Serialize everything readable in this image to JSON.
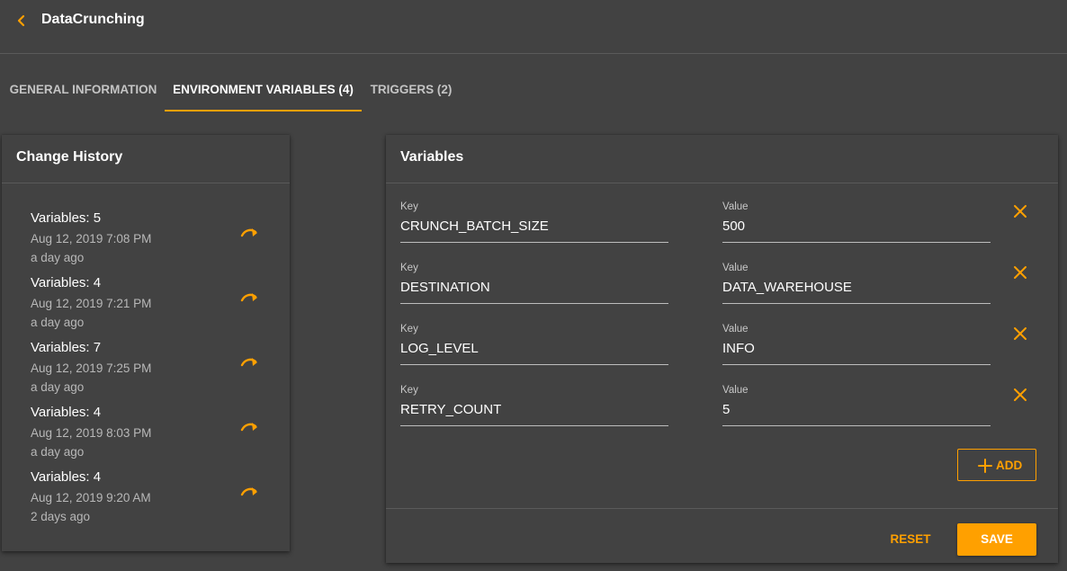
{
  "app": {
    "title": "DataCrunching"
  },
  "tabs": [
    {
      "label": "GENERAL INFORMATION",
      "active": false
    },
    {
      "label": "ENVIRONMENT VARIABLES (4)",
      "active": true
    },
    {
      "label": "TRIGGERS (2)",
      "active": false
    }
  ],
  "history": {
    "title": "Change History",
    "items": [
      {
        "title": "Variables: 5",
        "date": "Aug 12, 2019 7:08 PM",
        "ago": "a day ago"
      },
      {
        "title": "Variables: 4",
        "date": "Aug 12, 2019 7:21 PM",
        "ago": "a day ago"
      },
      {
        "title": "Variables: 7",
        "date": "Aug 12, 2019 7:25 PM",
        "ago": "a day ago"
      },
      {
        "title": "Variables: 4",
        "date": "Aug 12, 2019 8:03 PM",
        "ago": "a day ago"
      },
      {
        "title": "Variables: 4",
        "date": "Aug 12, 2019 9:20 AM",
        "ago": "2 days ago"
      }
    ]
  },
  "variables": {
    "title": "Variables",
    "key_label": "Key",
    "value_label": "Value",
    "rows": [
      {
        "key": "CRUNCH_BATCH_SIZE",
        "value": "500"
      },
      {
        "key": "DESTINATION",
        "value": "DATA_WAREHOUSE"
      },
      {
        "key": "LOG_LEVEL",
        "value": "INFO"
      },
      {
        "key": "RETRY_COUNT",
        "value": "5"
      }
    ],
    "add_label": "ADD",
    "reset_label": "RESET",
    "save_label": "SAVE"
  },
  "colors": {
    "accent": "#ffa000",
    "background": "#424242",
    "divider": "#5a5a5a"
  },
  "icons": {
    "back": "chevron-left-icon",
    "restore": "redo-arrow-icon",
    "delete": "close-icon",
    "add": "plus-icon"
  }
}
